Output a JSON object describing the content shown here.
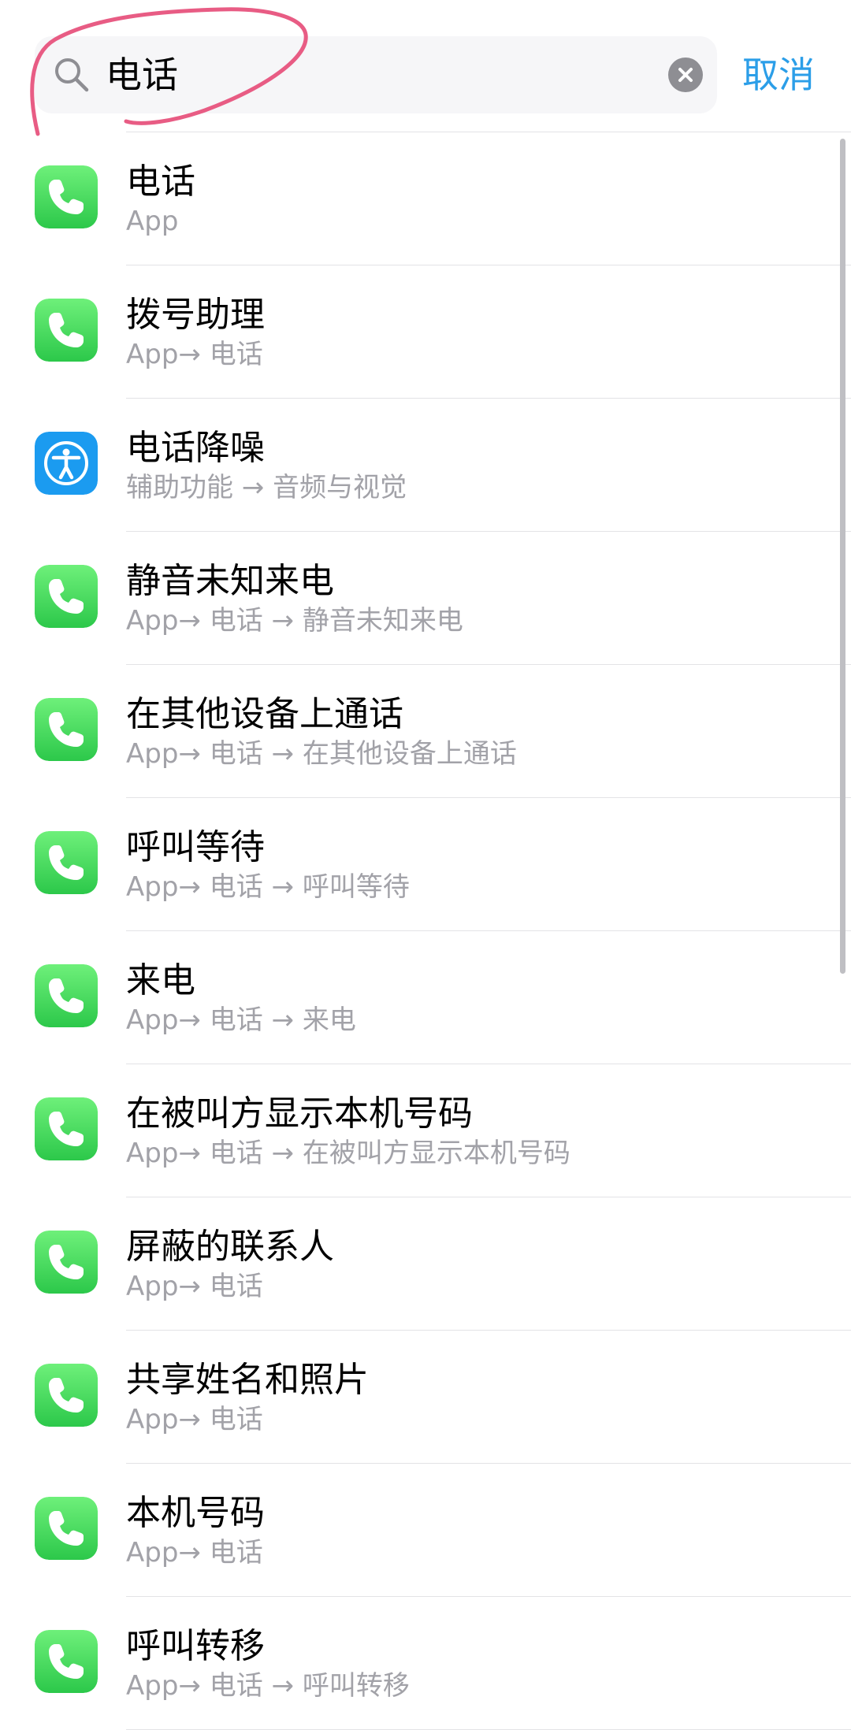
{
  "search": {
    "query": "电话",
    "cancel_label": "取消"
  },
  "colors": {
    "accent": "#2b9ee8",
    "phone_icon": "#4cd964",
    "accessibility_icon": "#1b9bf0",
    "annotation": "#e85c84"
  },
  "results": [
    {
      "title": "电话",
      "path": "App",
      "icon": "phone-icon"
    },
    {
      "title": "拨号助理",
      "path": "App→ 电话",
      "icon": "phone-icon"
    },
    {
      "title": "电话降噪",
      "path": "辅助功能 → 音频与视觉",
      "icon": "accessibility-icon"
    },
    {
      "title": "静音未知来电",
      "path": "App→ 电话 → 静音未知来电",
      "icon": "phone-icon"
    },
    {
      "title": "在其他设备上通话",
      "path": "App→ 电话 → 在其他设备上通话",
      "icon": "phone-icon"
    },
    {
      "title": "呼叫等待",
      "path": "App→ 电话 → 呼叫等待",
      "icon": "phone-icon"
    },
    {
      "title": "来电",
      "path": "App→ 电话 → 来电",
      "icon": "phone-icon"
    },
    {
      "title": "在被叫方显示本机号码",
      "path": "App→ 电话 → 在被叫方显示本机号码",
      "icon": "phone-icon"
    },
    {
      "title": "屏蔽的联系人",
      "path": "App→ 电话",
      "icon": "phone-icon"
    },
    {
      "title": "共享姓名和照片",
      "path": "App→ 电话",
      "icon": "phone-icon"
    },
    {
      "title": "本机号码",
      "path": "App→ 电话",
      "icon": "phone-icon"
    },
    {
      "title": "呼叫转移",
      "path": "App→ 电话 → 呼叫转移",
      "icon": "phone-icon"
    }
  ]
}
